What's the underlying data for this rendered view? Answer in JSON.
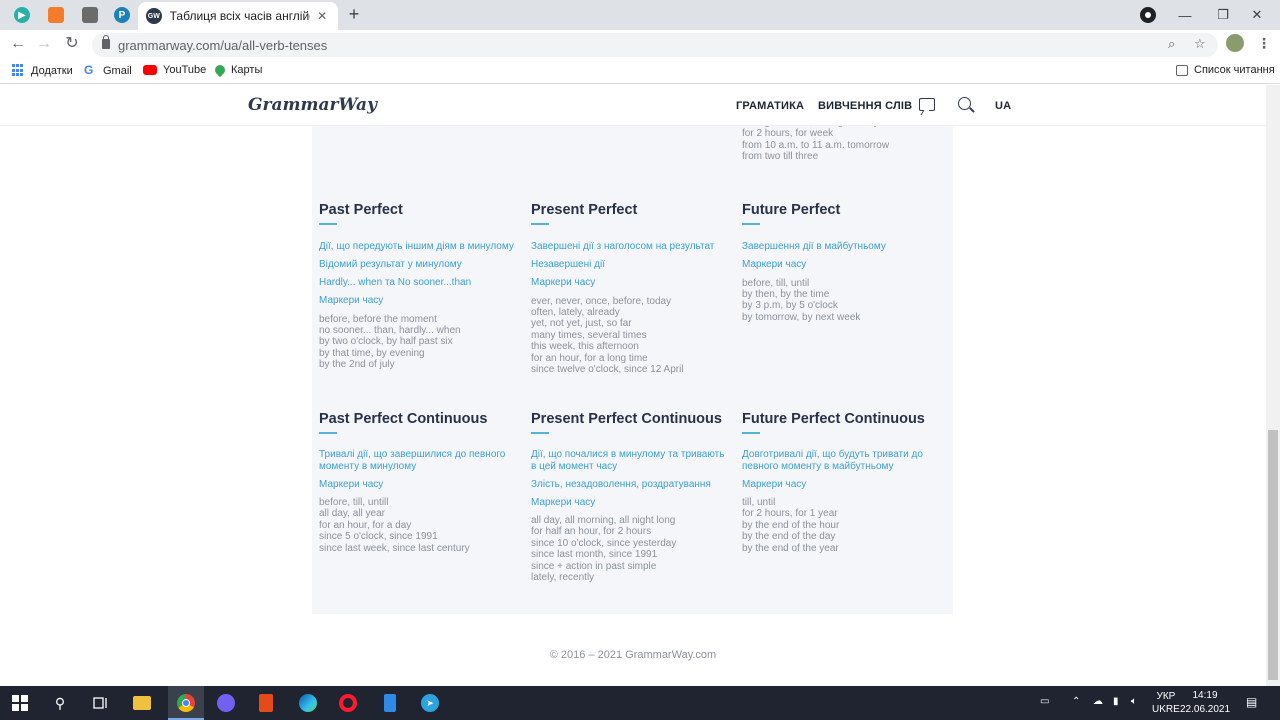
{
  "browser": {
    "tab_title": "Таблиця всіх часів англійської мови",
    "tab_favicon_text": "GW",
    "url": "grammarway.com/ua/all-verb-tenses",
    "bookmarks": [
      "Додатки",
      "Gmail",
      "YouTube",
      "Карты"
    ],
    "reading_list": "Список читання",
    "accent": "#3aa0d2"
  },
  "site": {
    "logo": "GrammarWay",
    "nav": [
      "ГРАМАТИКА",
      "ВИВЧЕННЯ СЛІВ"
    ],
    "lang": "UA"
  },
  "top_fragment": {
    "lines": [
      "during this time, during the day",
      "for 2 hours, for week",
      "from 10 a.m. to 11 a.m. tomorrow",
      "from two till three"
    ]
  },
  "perfect": {
    "past": {
      "title": "Past Perfect",
      "links": [
        "Дії, що передують іншим діям в минулому",
        "Відомий результат у минулому",
        "Hardly... when та No sooner...than",
        "Маркери часу"
      ],
      "markers": [
        "before, before the moment",
        "no sooner... than, hardly... when",
        "by two o'clock, by half past six",
        "by that time, by evening",
        "by the 2nd of july"
      ]
    },
    "present": {
      "title": "Present Perfect",
      "links": [
        "Завершені дії з наголосом на результат",
        "Незавершені дії",
        "Маркери часу"
      ],
      "markers": [
        "ever, never, once, before, today",
        "often, lately, already",
        "yet, not yet, just, so far",
        "many times, several times",
        "this week, this afternoon",
        "for an hour, for a long time",
        "since twelve o'clock, since 12 April"
      ]
    },
    "future": {
      "title": "Future Perfect",
      "links": [
        "Завершення дії в майбутньому",
        "Маркери часу"
      ],
      "markers": [
        "before, till, until",
        "by then, by the time",
        "by 3 p.m, by 5 o'clock",
        "by tomorrow, by next week"
      ]
    }
  },
  "perfect_continuous": {
    "past": {
      "title": "Past Perfect Continuous",
      "links": [
        "Тривалі дії, що завершилися до певного моменту в минулому",
        "Маркери часу"
      ],
      "markers": [
        "before, till, untill",
        "all day, all year",
        "for an hour, for a day",
        "since 5 o'clock, since 1991",
        "since last week, since last century"
      ]
    },
    "present": {
      "title": "Present Perfect Continuous",
      "links": [
        "Дії, що почалися в минулому та тривають в цей момент часу",
        "Злість, незадоволення, роздратування",
        "Маркери часу"
      ],
      "markers": [
        "all day, all morning, all night long",
        "for half an hour, for 2 hours",
        "since 10 o'clock, since yesterday",
        "since last month, since 1991",
        "since + action in past simple",
        "lately, recently"
      ]
    },
    "future": {
      "title": "Future Perfect Continuous",
      "links": [
        "Довготривалі дії, що будуть тривати до певного моменту в майбутньому",
        "Маркери часу"
      ],
      "markers": [
        "till, until",
        "for 2 hours, for 1 year",
        "by the end of the hour",
        "by the end of the day",
        "by the end of the year"
      ]
    }
  },
  "footer": {
    "copyright": "© 2016 – 2021  GrammarWay.com"
  },
  "taskbar": {
    "lang": "УКР",
    "layout": "UKRE",
    "time": "14:19",
    "date": "22.06.2021"
  }
}
